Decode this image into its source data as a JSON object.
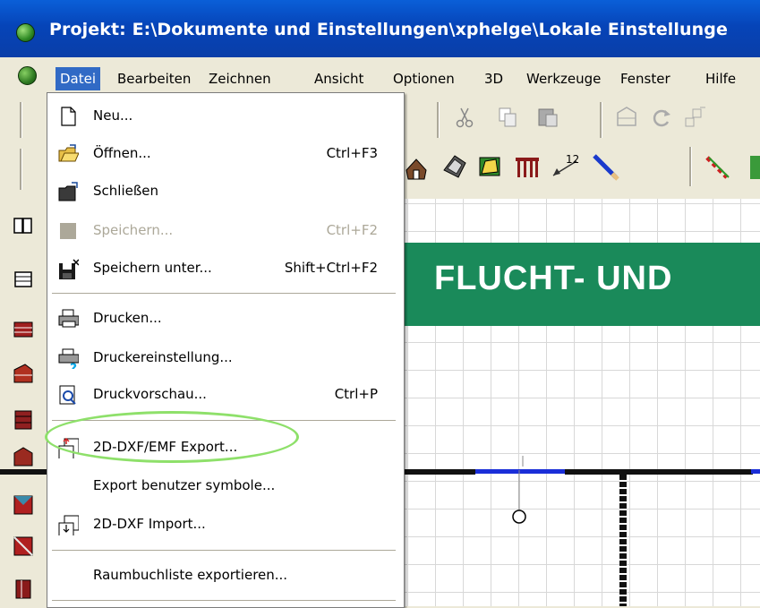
{
  "window": {
    "title": "Projekt: E:\\Dokumente und Einstellungen\\xphelge\\Lokale Einstellunge"
  },
  "menubar": {
    "items": [
      "Datei",
      "Bearbeiten",
      "Zeichnen",
      "Ansicht",
      "Optionen",
      "3D",
      "Werkzeuge",
      "Fenster",
      "Hilfe"
    ],
    "active": "Datei"
  },
  "datei_menu": {
    "items": [
      {
        "label": "Neu...",
        "shortcut": "",
        "icon": "new-document-icon",
        "enabled": true
      },
      {
        "label": "Öffnen...",
        "shortcut": "Ctrl+F3",
        "icon": "open-folder-icon",
        "enabled": true
      },
      {
        "label": "Schließen",
        "shortcut": "",
        "icon": "close-folder-icon",
        "enabled": true
      },
      {
        "label": "Speichern...",
        "shortcut": "Ctrl+F2",
        "icon": "save-icon",
        "enabled": false
      },
      {
        "label": "Speichern unter...",
        "shortcut": "Shift+Ctrl+F2",
        "icon": "save-as-icon",
        "enabled": true
      },
      {
        "label": "Drucken...",
        "shortcut": "",
        "icon": "printer-icon",
        "enabled": true
      },
      {
        "label": "Druckereinstellung...",
        "shortcut": "",
        "icon": "printer-settings-icon",
        "enabled": true
      },
      {
        "label": "Druckvorschau...",
        "shortcut": "Ctrl+P",
        "icon": "print-preview-icon",
        "enabled": true
      },
      {
        "label": "2D-DXF/EMF Export...",
        "shortcut": "",
        "icon": "dxf-export-icon",
        "enabled": true
      },
      {
        "label": "Export benutzer symbole...",
        "shortcut": "",
        "icon": "",
        "enabled": true
      },
      {
        "label": "2D-DXF Import...",
        "shortcut": "",
        "icon": "dxf-import-icon",
        "enabled": true
      },
      {
        "label": "Raumbuchliste exportieren...",
        "shortcut": "",
        "icon": "",
        "enabled": true
      }
    ]
  },
  "canvas": {
    "banner_text": "FLUCHT- UND",
    "colors": {
      "banner": "#1a8a5a",
      "wall": "#111111",
      "door": "#1a2ed8"
    }
  },
  "toolbar": {
    "label_12": "12"
  },
  "colors": {
    "titlebar": "#0a4fc8",
    "menu_highlight": "#316ac5",
    "annotation_ellipse": "#8ee06a"
  }
}
